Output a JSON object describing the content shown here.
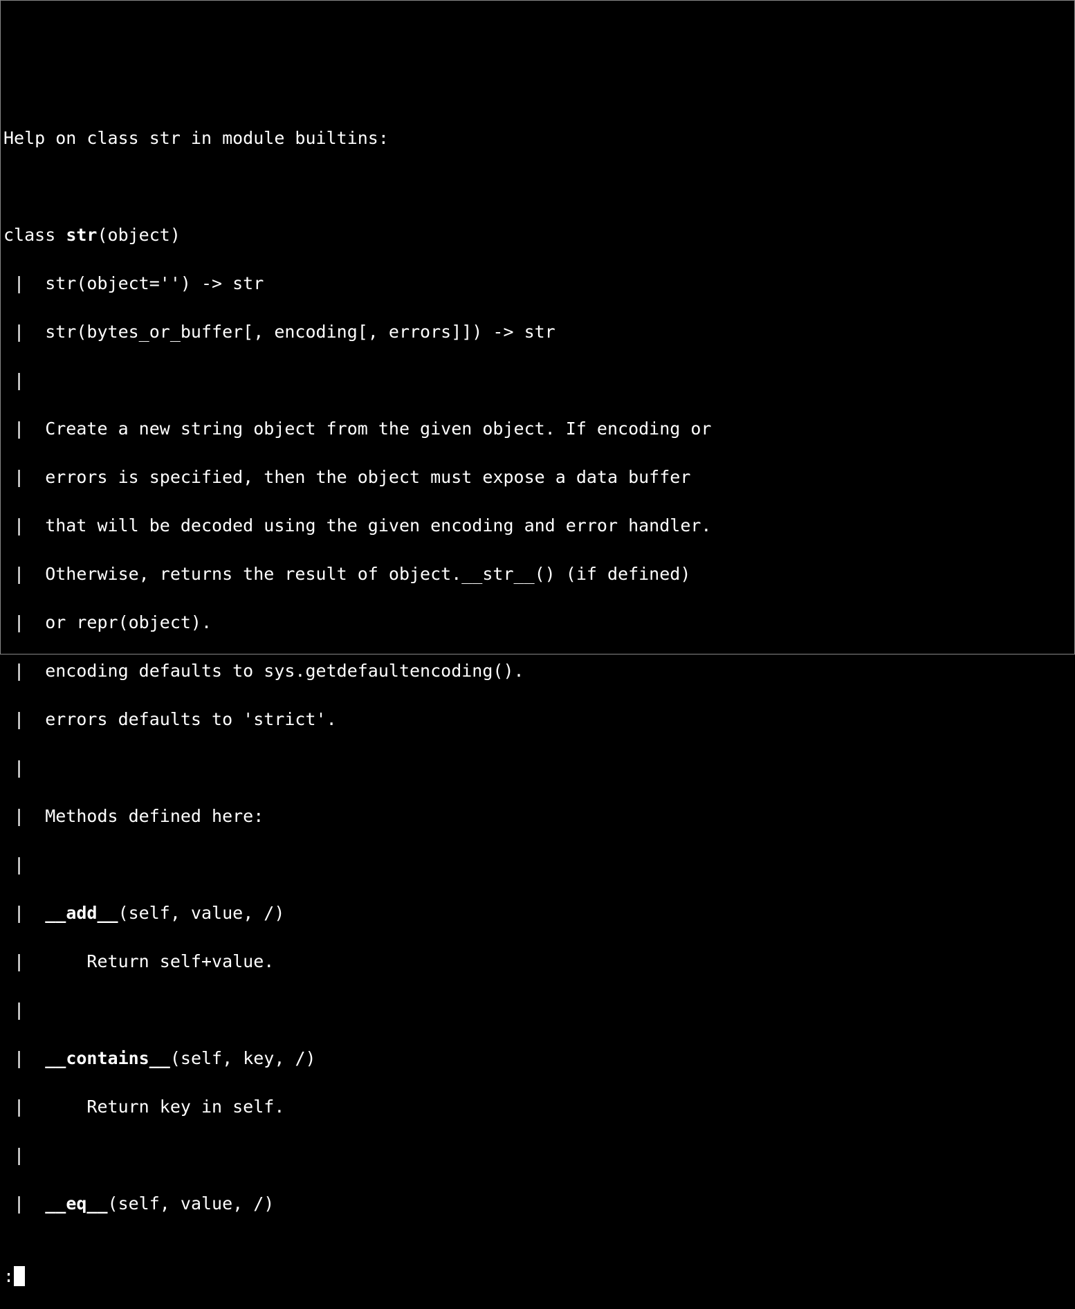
{
  "help": {
    "header_line": "Help on class str in module builtins:",
    "blank": "",
    "class_prefix": "class ",
    "class_bold": "str",
    "class_suffix": "(object)",
    "sig1": " |  str(object='') -> str",
    "sig2": " |  str(bytes_or_buffer[, encoding[, errors]]) -> str",
    "pipe": " |",
    "desc1": " |  Create a new string object from the given object. If encoding or",
    "desc2": " |  errors is specified, then the object must expose a data buffer",
    "desc3": " |  that will be decoded using the given encoding and error handler.",
    "desc4": " |  Otherwise, returns the result of object.__str__() (if defined)",
    "desc5": " |  or repr(object).",
    "desc6": " |  encoding defaults to sys.getdefaultencoding().",
    "desc7": " |  errors defaults to 'strict'.",
    "methods_header": " |  Methods defined here:",
    "m1_prefix": " |  ",
    "m1_bold": "__add__",
    "m1_suffix": "(self, value, /)",
    "m1_body": " |      Return self+value.",
    "m2_prefix": " |  ",
    "m2_bold": "__contains__",
    "m2_suffix": "(self, key, /)",
    "m2_body": " |      Return key in self.",
    "m3_prefix": " |  ",
    "m3_bold": "__eq__",
    "m3_suffix": "(self, value, /)",
    "pager_prompt": ":"
  }
}
